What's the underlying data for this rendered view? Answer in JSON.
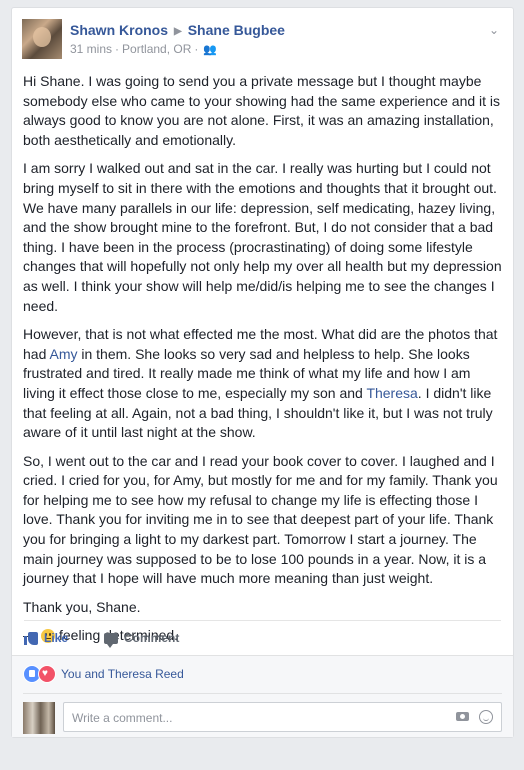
{
  "post": {
    "author": "Shawn Kronos",
    "target": "Shane Bugbee",
    "time": "31 mins",
    "location": "Portland, OR",
    "paragraphs": [
      {
        "segments": [
          {
            "text": "Hi Shane. I was going to send you a private message but I thought maybe somebody else who came to your showing had the same experience and it is always good to know you are not alone. First, it was an amazing installation, both aesthetically and emotionally."
          }
        ]
      },
      {
        "segments": [
          {
            "text": "I am sorry I walked out and sat in the car. I really was hurting but I could not bring myself to sit in there with the emotions and thoughts that it brought out. We have many parallels in our life: depression, self medicating, hazey living, and the show brought mine to the forefront. But, I do not consider that a bad thing. I have been in the process (procrastinating) of doing some lifestyle changes that will hopefully not only help my over all health but my depression as well. I think your show will help me/did/is helping me to see the changes I need."
          }
        ]
      },
      {
        "segments": [
          {
            "text": "However, that is not what effected me the most. What did are the photos that had "
          },
          {
            "text": "Amy",
            "link": true
          },
          {
            "text": " in them. She looks so very sad and helpless to help. She looks frustrated and tired. It really made me think of what my life and how I am living it effect those close to me, especially my son and "
          },
          {
            "text": "Theresa",
            "link": true
          },
          {
            "text": ". I didn't like that feeling at all. Again, not a bad thing, I shouldn't like it, but I was not truly aware of it until last night at the show."
          }
        ]
      },
      {
        "segments": [
          {
            "text": "So, I went out to the car and I read your book cover to cover. I laughed and I cried. I cried for you, for Amy, but mostly for me and for my family. Thank you for helping me to see how my refusal to change my life is effecting those I love. Thank you for inviting me in to see that deepest part of your life. Thank you for bringing a light to my darkest part. Tomorrow I start a journey. The main journey was supposed to be to lose 100 pounds in a year. Now, it is a journey that I hope will have much more meaning than just weight."
          }
        ]
      },
      {
        "segments": [
          {
            "text": "Thank you, Shane."
          }
        ]
      }
    ],
    "feeling_prefix": "—",
    "feeling": "feeling determined."
  },
  "actions": {
    "like": "Like",
    "comment": "Comment"
  },
  "reactions": {
    "who": "You and Theresa Reed"
  },
  "comment_box": {
    "placeholder": "Write a comment..."
  }
}
